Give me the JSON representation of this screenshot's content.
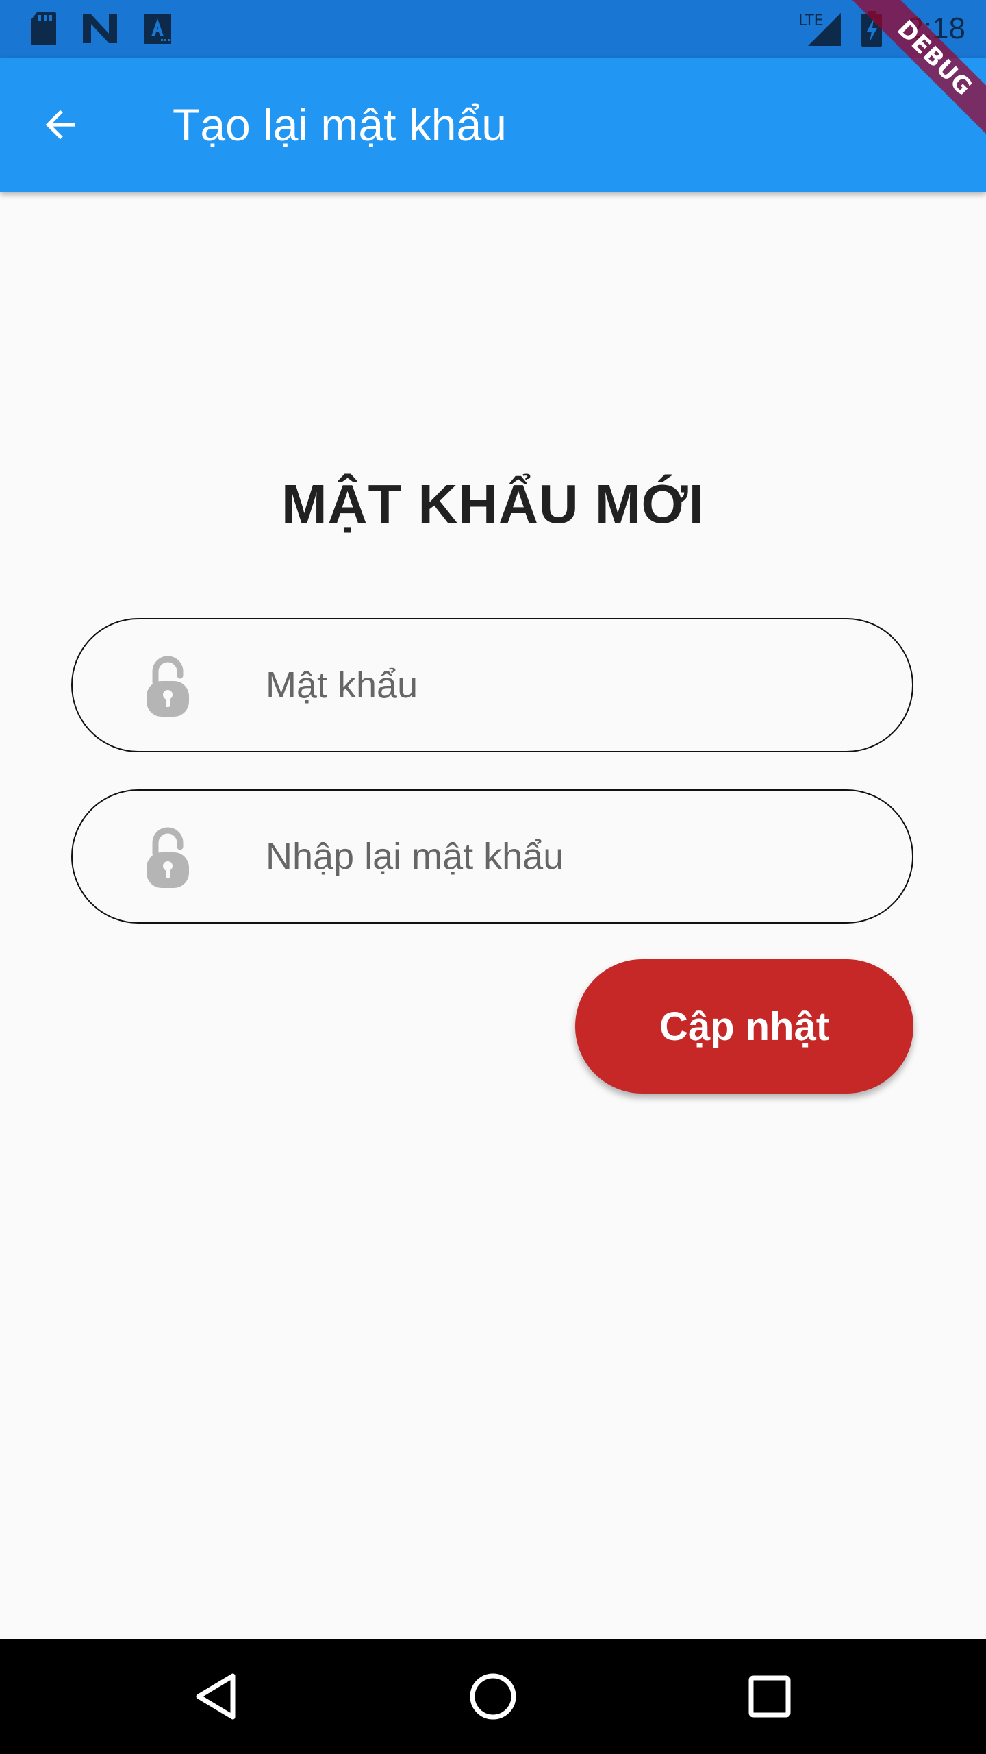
{
  "status_bar": {
    "time": "2:18",
    "icons": [
      "sd-card-icon",
      "n-logo-icon",
      "a-app-icon",
      "lte-signal-icon",
      "battery-charging-icon"
    ],
    "lte_label": "LTE"
  },
  "debug_banner": {
    "label": "DEBUG"
  },
  "app_bar": {
    "title": "Tạo lại mật khẩu",
    "back_icon": "arrow-back-icon",
    "background": "#2196f3"
  },
  "form": {
    "heading": "MẬT KHẨU MỚI",
    "password": {
      "placeholder": "Mật khẩu",
      "value": "",
      "icon": "lock-icon"
    },
    "confirm_password": {
      "placeholder": "Nhập lại mật khẩu",
      "value": "",
      "icon": "lock-icon"
    },
    "submit_label": "Cập nhật",
    "submit_color": "#c62828"
  },
  "nav_bar": {
    "buttons": [
      "back-triangle-icon",
      "home-circle-icon",
      "recents-square-icon"
    ]
  }
}
